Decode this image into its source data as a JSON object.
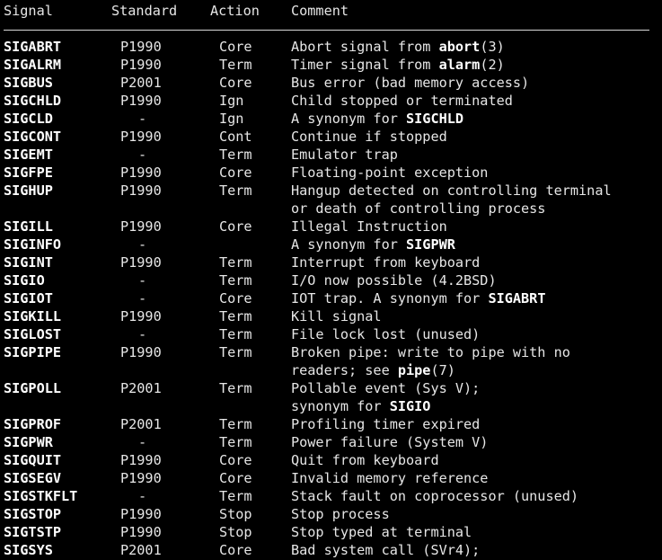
{
  "header": {
    "signal": "Signal",
    "standard": "Standard",
    "action": "Action",
    "comment": "Comment"
  },
  "rows": [
    {
      "signal": "SIGABRT",
      "standard": "P1990",
      "action": "Core",
      "comment": [
        {
          "t": "Abort signal from "
        },
        {
          "t": "abort",
          "b": true
        },
        {
          "t": "(3)"
        }
      ]
    },
    {
      "signal": "SIGALRM",
      "standard": "P1990",
      "action": "Term",
      "comment": [
        {
          "t": "Timer signal from "
        },
        {
          "t": "alarm",
          "b": true
        },
        {
          "t": "(2)"
        }
      ]
    },
    {
      "signal": "SIGBUS",
      "standard": "P2001",
      "action": "Core",
      "comment": [
        {
          "t": "Bus error (bad memory access)"
        }
      ]
    },
    {
      "signal": "SIGCHLD",
      "standard": "P1990",
      "action": "Ign",
      "comment": [
        {
          "t": "Child stopped or terminated"
        }
      ]
    },
    {
      "signal": "SIGCLD",
      "standard": "-",
      "action": "Ign",
      "comment": [
        {
          "t": "A synonym for "
        },
        {
          "t": "SIGCHLD",
          "b": true
        }
      ]
    },
    {
      "signal": "SIGCONT",
      "standard": "P1990",
      "action": "Cont",
      "comment": [
        {
          "t": "Continue if stopped"
        }
      ]
    },
    {
      "signal": "SIGEMT",
      "standard": "-",
      "action": "Term",
      "comment": [
        {
          "t": "Emulator trap"
        }
      ]
    },
    {
      "signal": "SIGFPE",
      "standard": "P1990",
      "action": "Core",
      "comment": [
        {
          "t": "Floating-point exception"
        }
      ]
    },
    {
      "signal": "SIGHUP",
      "standard": "P1990",
      "action": "Term",
      "comment": [
        {
          "t": "Hangup detected on controlling terminal"
        }
      ]
    },
    {
      "signal": "",
      "standard": "",
      "action": "",
      "comment": [
        {
          "t": "or death of controlling process"
        }
      ]
    },
    {
      "signal": "SIGILL",
      "standard": "P1990",
      "action": "Core",
      "comment": [
        {
          "t": "Illegal Instruction"
        }
      ]
    },
    {
      "signal": "SIGINFO",
      "standard": "-",
      "action": "",
      "comment": [
        {
          "t": "A synonym for "
        },
        {
          "t": "SIGPWR",
          "b": true
        }
      ]
    },
    {
      "signal": "SIGINT",
      "standard": "P1990",
      "action": "Term",
      "comment": [
        {
          "t": "Interrupt from keyboard"
        }
      ]
    },
    {
      "signal": "SIGIO",
      "standard": "-",
      "action": "Term",
      "comment": [
        {
          "t": "I/O now possible (4.2BSD)"
        }
      ]
    },
    {
      "signal": "SIGIOT",
      "standard": "-",
      "action": "Core",
      "comment": [
        {
          "t": "IOT trap. A synonym for "
        },
        {
          "t": "SIGABRT",
          "b": true
        }
      ]
    },
    {
      "signal": "SIGKILL",
      "standard": "P1990",
      "action": "Term",
      "comment": [
        {
          "t": "Kill signal"
        }
      ]
    },
    {
      "signal": "SIGLOST",
      "standard": "-",
      "action": "Term",
      "comment": [
        {
          "t": "File lock lost (unused)"
        }
      ]
    },
    {
      "signal": "SIGPIPE",
      "standard": "P1990",
      "action": "Term",
      "comment": [
        {
          "t": "Broken pipe: write to pipe with no"
        }
      ]
    },
    {
      "signal": "",
      "standard": "",
      "action": "",
      "comment": [
        {
          "t": "readers; see "
        },
        {
          "t": "pipe",
          "b": true
        },
        {
          "t": "(7)"
        }
      ]
    },
    {
      "signal": "SIGPOLL",
      "standard": "P2001",
      "action": "Term",
      "comment": [
        {
          "t": "Pollable event (Sys V);"
        }
      ]
    },
    {
      "signal": "",
      "standard": "",
      "action": "",
      "comment": [
        {
          "t": "synonym for "
        },
        {
          "t": "SIGIO",
          "b": true
        }
      ]
    },
    {
      "signal": "SIGPROF",
      "standard": "P2001",
      "action": "Term",
      "comment": [
        {
          "t": "Profiling timer expired"
        }
      ]
    },
    {
      "signal": "SIGPWR",
      "standard": "-",
      "action": "Term",
      "comment": [
        {
          "t": "Power failure (System V)"
        }
      ]
    },
    {
      "signal": "SIGQUIT",
      "standard": "P1990",
      "action": "Core",
      "comment": [
        {
          "t": "Quit from keyboard"
        }
      ]
    },
    {
      "signal": "SIGSEGV",
      "standard": "P1990",
      "action": "Core",
      "comment": [
        {
          "t": "Invalid memory reference"
        }
      ]
    },
    {
      "signal": "SIGSTKFLT",
      "standard": "-",
      "action": "Term",
      "comment": [
        {
          "t": "Stack fault on coprocessor (unused)"
        }
      ]
    },
    {
      "signal": "SIGSTOP",
      "standard": "P1990",
      "action": "Stop",
      "comment": [
        {
          "t": "Stop process"
        }
      ]
    },
    {
      "signal": "SIGTSTP",
      "standard": "P1990",
      "action": "Stop",
      "comment": [
        {
          "t": "Stop typed at terminal"
        }
      ]
    },
    {
      "signal": "SIGSYS",
      "standard": "P2001",
      "action": "Core",
      "comment": [
        {
          "t": "Bad system call (SVr4);"
        }
      ]
    }
  ],
  "colors": {
    "background": "#000000",
    "text": "#e6e6e6",
    "bold_text": "#ffffff",
    "rule": "#d8d8d8"
  }
}
